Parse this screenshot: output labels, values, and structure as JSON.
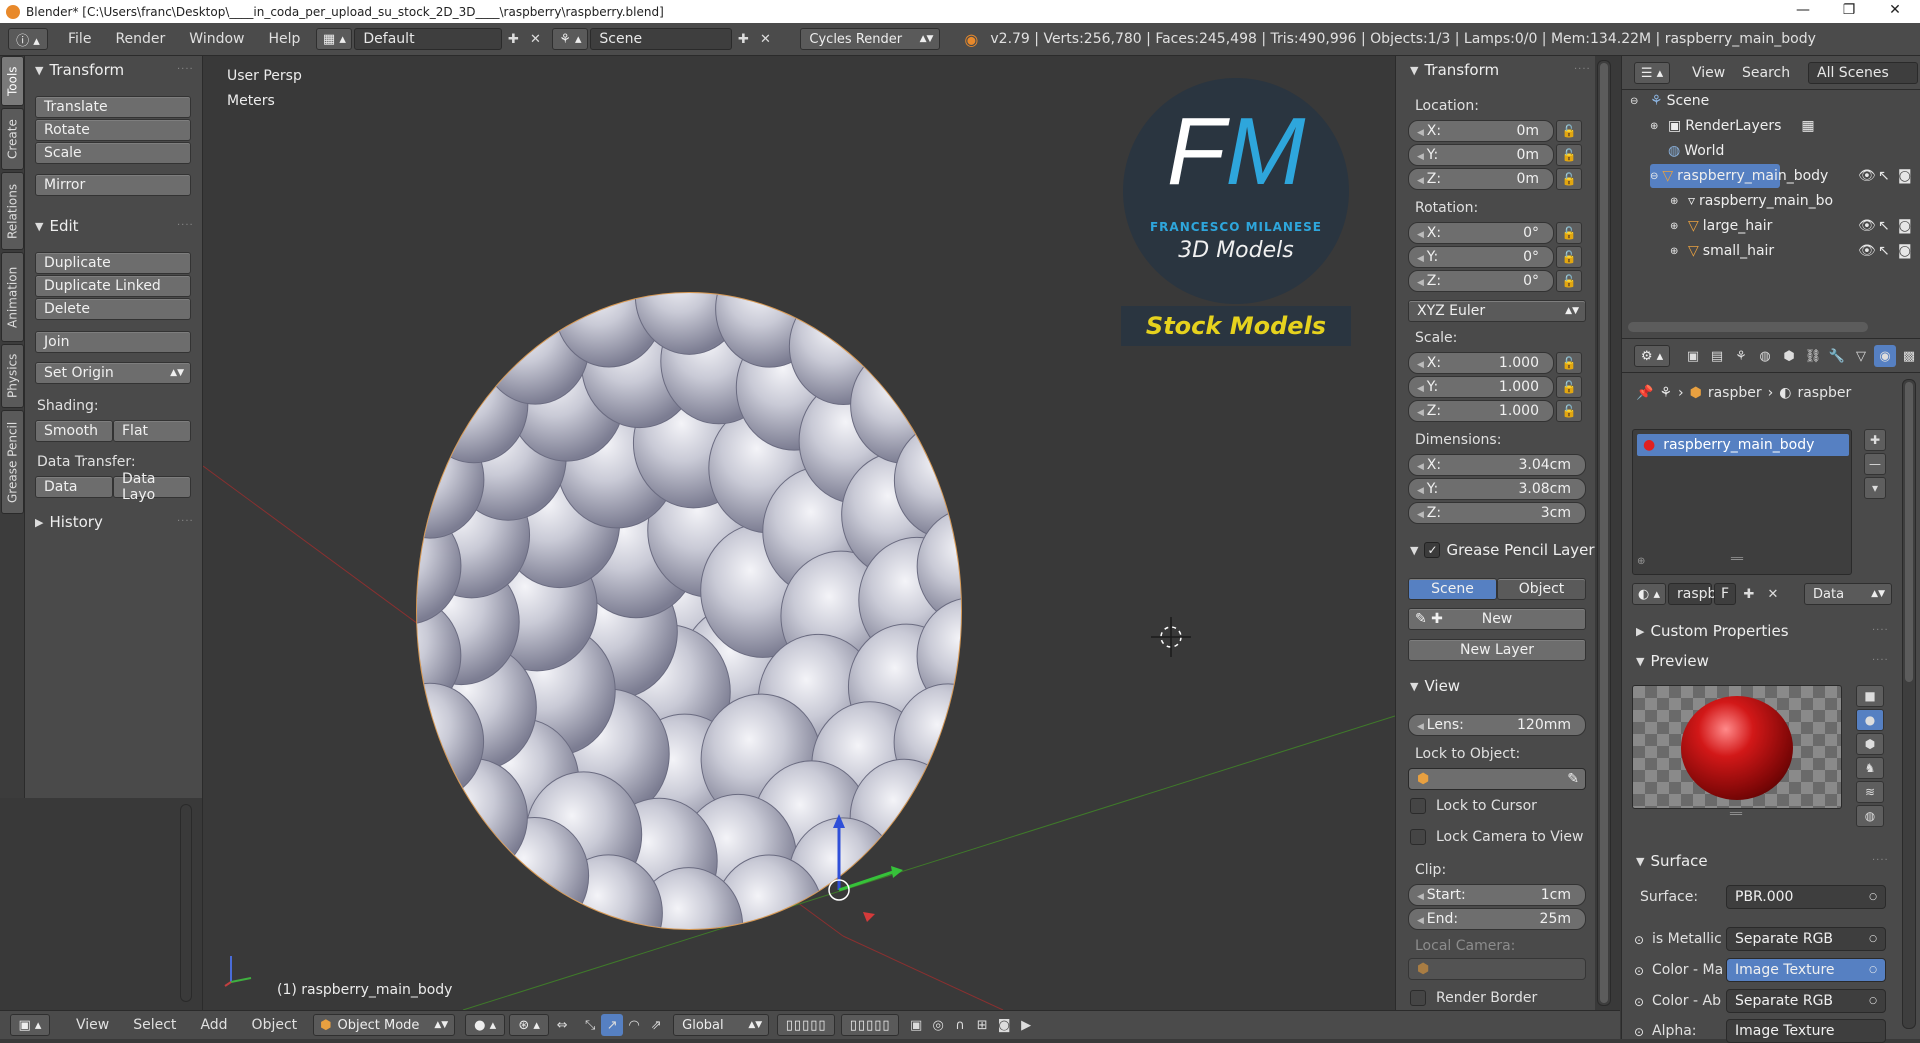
{
  "window": {
    "title": "Blender* [C:\\Users\\franc\\Desktop\\____in_coda_per_upload_su_stock_2D_3D____\\raspberry\\raspberry.blend]",
    "minimize": "—",
    "maximize": "❐",
    "close": "✕"
  },
  "menubar": {
    "items": [
      "File",
      "Render",
      "Window",
      "Help"
    ],
    "layout": "Default",
    "scene": "Scene",
    "engine": "Cycles Render",
    "stats": "v2.79 | Verts:256,780 | Faces:245,498 | Tris:490,996 | Objects:1/3 | Lamps:0/0 | Mem:134.22M | raspberry_main_body"
  },
  "tool_tabs": [
    "Tools",
    "Create",
    "Relations",
    "Animation",
    "Physics",
    "Grease Pencil"
  ],
  "toolshelf": {
    "transform": {
      "title": "Transform",
      "translate": "Translate",
      "rotate": "Rotate",
      "scale": "Scale",
      "mirror": "Mirror"
    },
    "edit": {
      "title": "Edit",
      "duplicate": "Duplicate",
      "duplicate_linked": "Duplicate Linked",
      "delete": "Delete",
      "join": "Join",
      "set_origin": "Set Origin",
      "shading_label": "Shading:",
      "smooth": "Smooth",
      "flat": "Flat",
      "data_transfer_label": "Data Transfer:",
      "data": "Data",
      "data_layout": "Data Layo"
    },
    "history": {
      "title": "History"
    }
  },
  "viewport": {
    "view_name": "User Persp",
    "units": "Meters",
    "object_label": "(1) raspberry_main_body",
    "watermark": {
      "letters": "FM",
      "name": "FRANCESCO MILANESE",
      "subtitle": "3D Models",
      "stock": "Stock Models"
    }
  },
  "npanel": {
    "transform_title": "Transform",
    "location_label": "Location:",
    "location": {
      "x": "0m",
      "y": "0m",
      "z": "0m"
    },
    "rotation_label": "Rotation:",
    "rotation": {
      "x": "0°",
      "y": "0°",
      "z": "0°"
    },
    "rotation_mode": "XYZ Euler",
    "scale_label": "Scale:",
    "scale": {
      "x": "1.000",
      "y": "1.000",
      "z": "1.000"
    },
    "dimensions_label": "Dimensions:",
    "dimensions": {
      "x": "3.04cm",
      "y": "3.08cm",
      "z": "3cm"
    },
    "axis": {
      "x": "X:",
      "y": "Y:",
      "z": "Z:"
    },
    "gp_title": "Grease Pencil Layer",
    "gp_scene": "Scene",
    "gp_object": "Object",
    "gp_new": "New",
    "gp_new_layer": "New Layer",
    "view_title": "View",
    "lens_label": "Lens:",
    "lens": "120mm",
    "lock_obj_label": "Lock to Object:",
    "lock_cursor": "Lock to Cursor",
    "lock_camera": "Lock Camera to View",
    "clip_label": "Clip:",
    "clip_start_label": "Start:",
    "clip_start": "1cm",
    "clip_end_label": "End:",
    "clip_end": "25m",
    "local_camera": "Local Camera:",
    "render_border": "Render Border"
  },
  "outliner": {
    "view": "View",
    "search": "Search",
    "scenes": "All Scenes",
    "rows": [
      "Scene",
      "RenderLayers",
      "World",
      "raspberry_main_body",
      "raspberry_main_bo",
      "large_hair",
      "small_hair"
    ]
  },
  "properties": {
    "breadcrumb_obj": "raspber",
    "breadcrumb_mat": "raspber",
    "material_slot": "raspberry_main_body",
    "mat_name": "raspb",
    "mat_f": "F",
    "mat_link": "Data",
    "custom_props": "Custom Properties",
    "preview": "Preview",
    "surface_title": "Surface",
    "surface_label": "Surface:",
    "surface_value": "PBR.000",
    "inputs": [
      {
        "label": "is Metallic",
        "value": "Separate RGB"
      },
      {
        "label": "Color - Ma",
        "value": "Image Texture"
      },
      {
        "label": "Color - Ab",
        "value": "Separate RGB"
      },
      {
        "label": "Alpha:",
        "value": "Image Texture"
      }
    ]
  },
  "statusbar": {
    "view": "View",
    "select": "Select",
    "add": "Add",
    "object": "Object",
    "mode": "Object Mode",
    "orientation": "Global"
  },
  "colors": {
    "accent": "#5680c2",
    "panel": "#4a4a4a",
    "viewport": "#393939",
    "fm_blue": "#2ea6dc",
    "stock_yellow": "#e6d21e"
  }
}
